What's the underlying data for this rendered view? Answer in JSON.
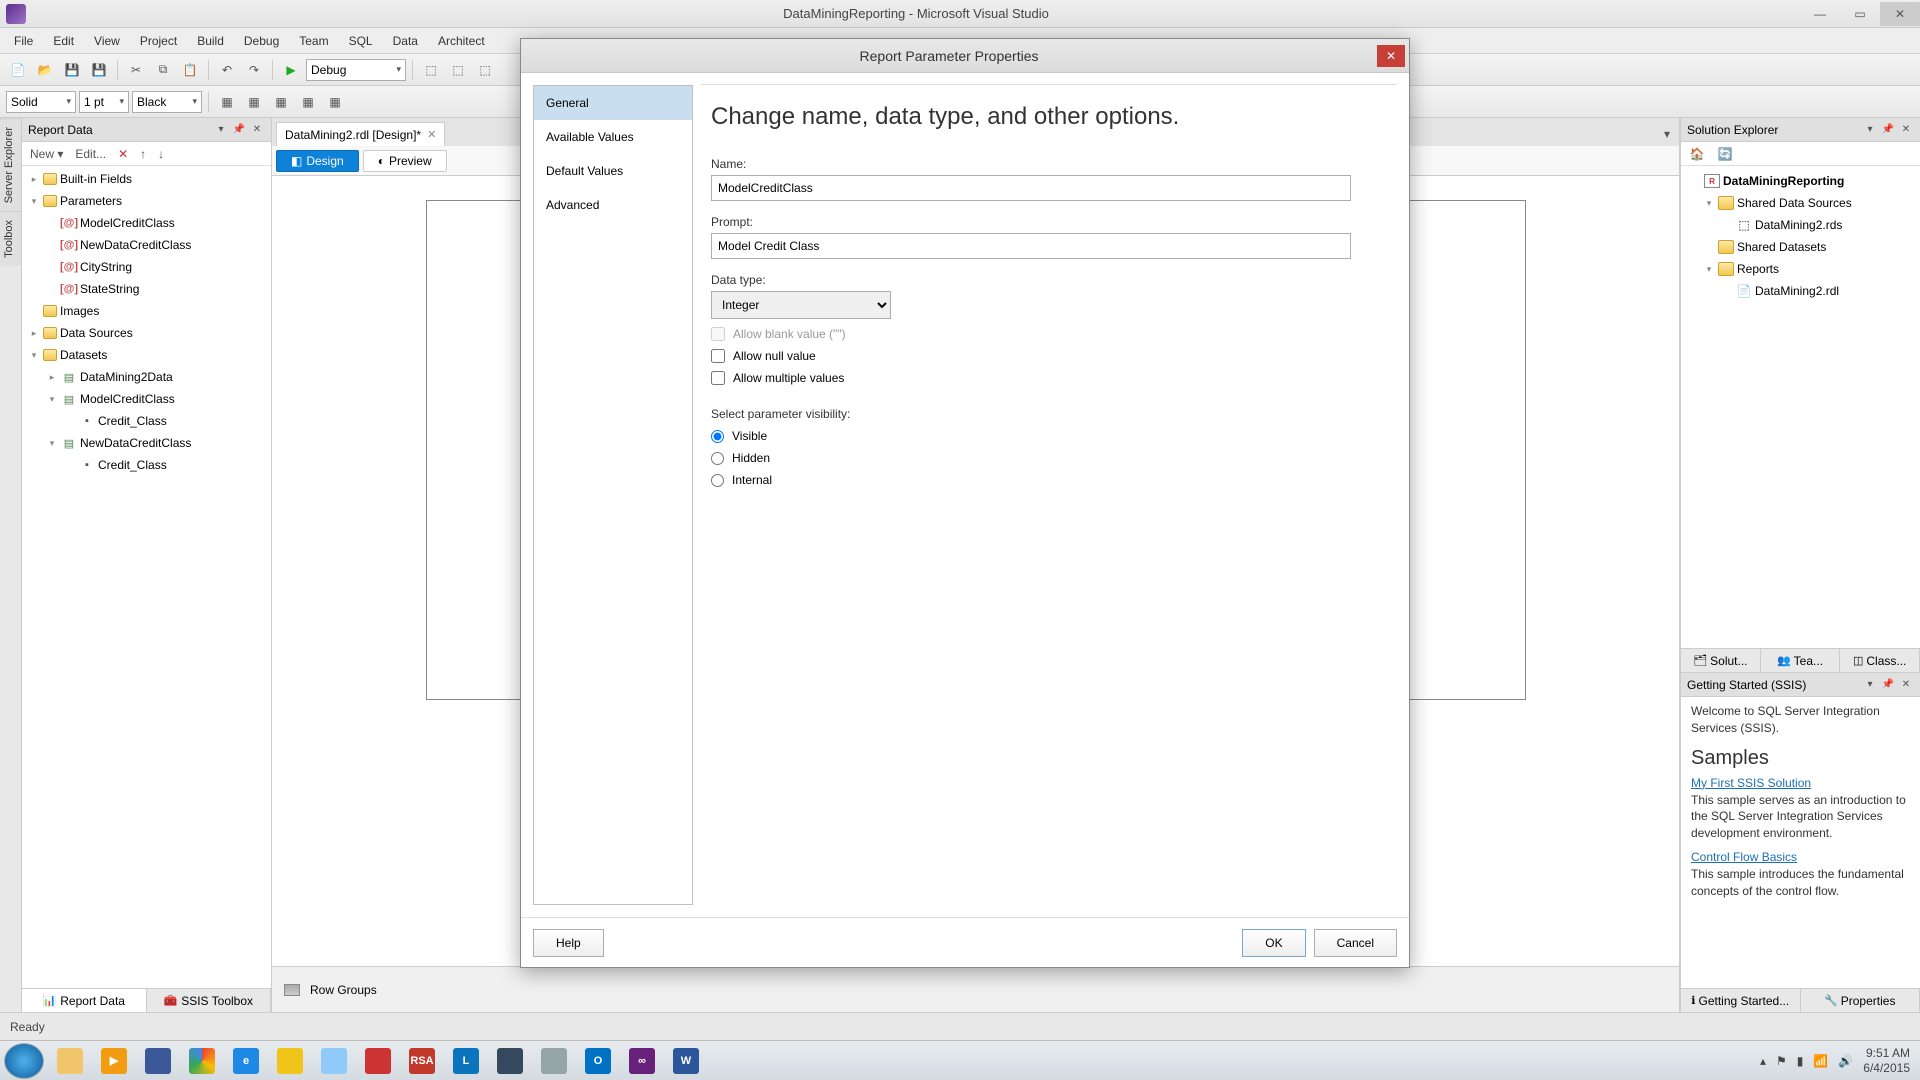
{
  "title": "DataMiningReporting - Microsoft Visual Studio",
  "menu": [
    "File",
    "Edit",
    "View",
    "Project",
    "Build",
    "Debug",
    "Team",
    "SQL",
    "Data",
    "Architect"
  ],
  "toolbar1": {
    "config": "Debug"
  },
  "toolbar2": {
    "line_style": "Solid",
    "line_width": "1 pt",
    "color": "Black"
  },
  "left_tabs": [
    "Server Explorer",
    "Toolbox"
  ],
  "report_data": {
    "title": "Report Data",
    "toolbar": {
      "new": "New",
      "edit": "Edit..."
    },
    "tree": {
      "builtin": "Built-in Fields",
      "parameters": "Parameters",
      "params": [
        "ModelCreditClass",
        "NewDataCreditClass",
        "CityString",
        "StateString"
      ],
      "images": "Images",
      "data_sources": "Data Sources",
      "datasets": "Datasets",
      "ds": [
        {
          "name": "DataMining2Data",
          "fields": []
        },
        {
          "name": "ModelCreditClass",
          "fields": [
            "Credit_Class"
          ]
        },
        {
          "name": "NewDataCreditClass",
          "fields": [
            "Credit_Class"
          ]
        }
      ]
    },
    "bottom_tabs": [
      "Report Data",
      "SSIS Toolbox"
    ]
  },
  "editor": {
    "doc_tab": "DataMining2.rdl [Design]*",
    "view_tabs": {
      "design": "Design",
      "preview": "Preview"
    },
    "row_groups": "Row Groups"
  },
  "solution": {
    "title": "Solution Explorer",
    "project": "DataMiningReporting",
    "folders": {
      "sds": "Shared Data Sources",
      "sds_item": "DataMining2.rds",
      "sdatasets": "Shared Datasets",
      "reports": "Reports",
      "report_item": "DataMining2.rdl"
    },
    "mid_tabs": [
      "Solut...",
      "Tea...",
      "Class..."
    ]
  },
  "getting_started": {
    "title": "Getting Started (SSIS)",
    "welcome": "Welcome to SQL Server Integration Services (SSIS).",
    "samples_heading": "Samples",
    "link1": "My First SSIS Solution",
    "desc1": "This sample serves as an introduction to the SQL Server Integration Services development environment.",
    "link2": "Control Flow Basics",
    "desc2": "This sample introduces the fundamental concepts of the control flow.",
    "bottom_tabs": [
      "Getting Started...",
      "Properties"
    ]
  },
  "status": "Ready",
  "clock": {
    "time": "9:51 AM",
    "date": "6/4/2015"
  },
  "dialog": {
    "title": "Report Parameter Properties",
    "nav": [
      "General",
      "Available Values",
      "Default Values",
      "Advanced"
    ],
    "heading": "Change name, data type, and other options.",
    "labels": {
      "name": "Name:",
      "prompt": "Prompt:",
      "datatype": "Data type:",
      "blank": "Allow blank value (\"\")",
      "null": "Allow null value",
      "multi": "Allow multiple values",
      "visibility": "Select parameter visibility:",
      "visible": "Visible",
      "hidden": "Hidden",
      "internal": "Internal"
    },
    "values": {
      "name": "ModelCreditClass",
      "prompt": "Model Credit Class",
      "datatype": "Integer"
    },
    "buttons": {
      "help": "Help",
      "ok": "OK",
      "cancel": "Cancel"
    }
  }
}
